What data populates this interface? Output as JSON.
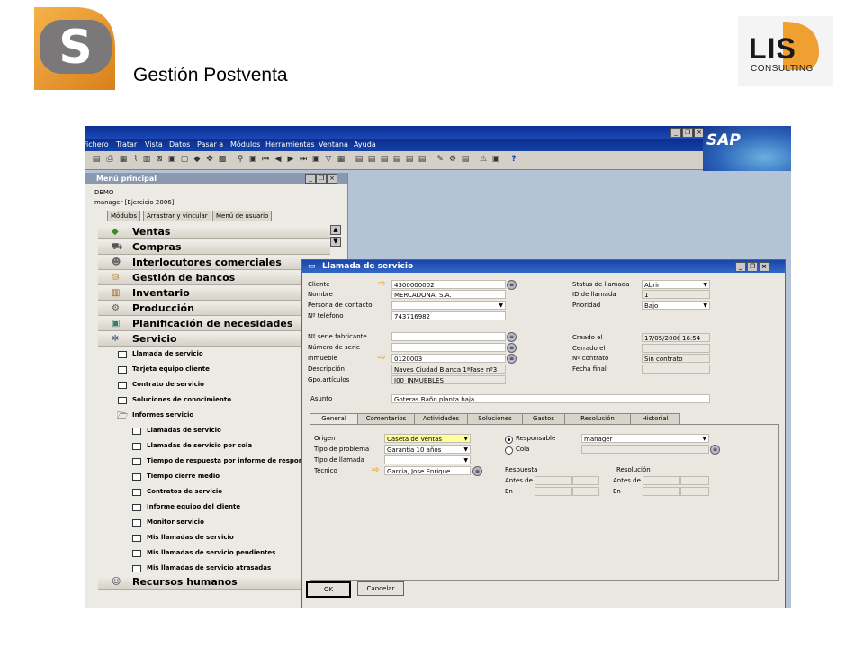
{
  "slide": {
    "title": "Gestión Postventa",
    "logo_left_letter": "S",
    "logo_right_text": "LIS",
    "logo_right_sub": "CONSULTING"
  },
  "sap": {
    "brand": "SAP",
    "menubar": [
      "Fichero",
      "Tratar",
      "Vista",
      "Datos",
      "Pasar a",
      "Módulos",
      "Herramientas",
      "Ventana",
      "Ayuda"
    ],
    "toolbar_help_glyph": "?"
  },
  "main_menu": {
    "title": "Menú principal",
    "company": "DEMO",
    "user_line": "manager  [Ejercicio 2006]",
    "tabs": [
      "Módulos",
      "Arrastrar y vincular",
      "Menú de usuario"
    ],
    "modules": [
      {
        "label": "Ventas",
        "icon": "ventas-icon"
      },
      {
        "label": "Compras",
        "icon": "compras-icon"
      },
      {
        "label": "Interlocutores comerciales",
        "icon": "interlocutores-icon"
      },
      {
        "label": "Gestión de bancos",
        "icon": "bancos-icon"
      },
      {
        "label": "Inventario",
        "icon": "inventario-icon"
      },
      {
        "label": "Producción",
        "icon": "produccion-icon"
      },
      {
        "label": "Planificación de necesidades",
        "icon": "planificacion-icon"
      },
      {
        "label": "Servicio",
        "icon": "servicio-icon"
      }
    ],
    "service_items": [
      "Llamada de servicio",
      "Tarjeta equipo cliente",
      "Contrato de servicio",
      "Soluciones de conocimiento"
    ],
    "reports_folder": "Informes servicio",
    "reports": [
      "Llamadas de servicio",
      "Llamadas de servicio por cola",
      "Tiempo de respuesta por informe de respons",
      "Tiempo cierre medio",
      "Contratos de servicio",
      "Informe equipo del cliente",
      "Monitor servicio",
      "Mis llamadas de servicio",
      "Mis llamadas de servicio pendientes",
      "Mis llamadas de servicio atrasadas"
    ],
    "last_module": "Recursos humanos"
  },
  "service_call": {
    "title": "Llamada de servicio",
    "left_labels": {
      "cliente": "Cliente",
      "nombre": "Nombre",
      "persona": "Persona de contacto",
      "telefono": "Nº teléfono",
      "serie_fab": "Nº serie fabricante",
      "num_serie": "Número de serie",
      "inmueble": "Inmueble",
      "descripcion": "Descripción",
      "gpo": "Gpo.artículos",
      "asunto": "Asunto"
    },
    "left_values": {
      "cliente": "4300000002",
      "nombre": "MERCADONA, S.A.",
      "persona": "",
      "telefono": "743716982",
      "serie_fab": "",
      "num_serie": "",
      "inmueble": "0120003",
      "descripcion": "Naves Ciudad Blanca 1ªFase nº3",
      "gpo": "I00_INMUEBLES",
      "asunto": "Goteras Baño planta baja"
    },
    "right_labels": {
      "status": "Status de llamada",
      "id": "ID de llamada",
      "prioridad": "Prioridad",
      "creado": "Creado el",
      "cerrado": "Cerrado el",
      "contrato": "Nº contrato",
      "fecha_final": "Fecha final"
    },
    "right_values": {
      "status": "Abrir",
      "id": "1",
      "prioridad": "Bajo",
      "creado_fecha": "17/05/2006",
      "creado_hora": "16:54",
      "cerrado": "",
      "contrato": "Sin contrato",
      "fecha_final": ""
    },
    "tabs": [
      "General",
      "Comentarios",
      "Actividades",
      "Soluciones",
      "Gastos",
      "Resolución",
      "Historial"
    ],
    "general": {
      "labels": {
        "origen": "Origen",
        "tipo_problema": "Tipo de problema",
        "tipo_llamada": "Tipo de llamada",
        "tecnico": "Técnico"
      },
      "values": {
        "origen": "Caseta de Ventas",
        "tipo_problema": "Garantia 10 años",
        "tipo_llamada": "",
        "tecnico": "Garcia, Jose Enrique"
      },
      "radio_responsable": "Responsable",
      "radio_cola": "Cola",
      "responsable_value": "manager",
      "respuesta": "Respuesta",
      "resolucion": "Resolución",
      "antes_de": "Antes de",
      "en": "En"
    },
    "buttons": {
      "ok": "OK",
      "cancel": "Cancelar"
    }
  }
}
